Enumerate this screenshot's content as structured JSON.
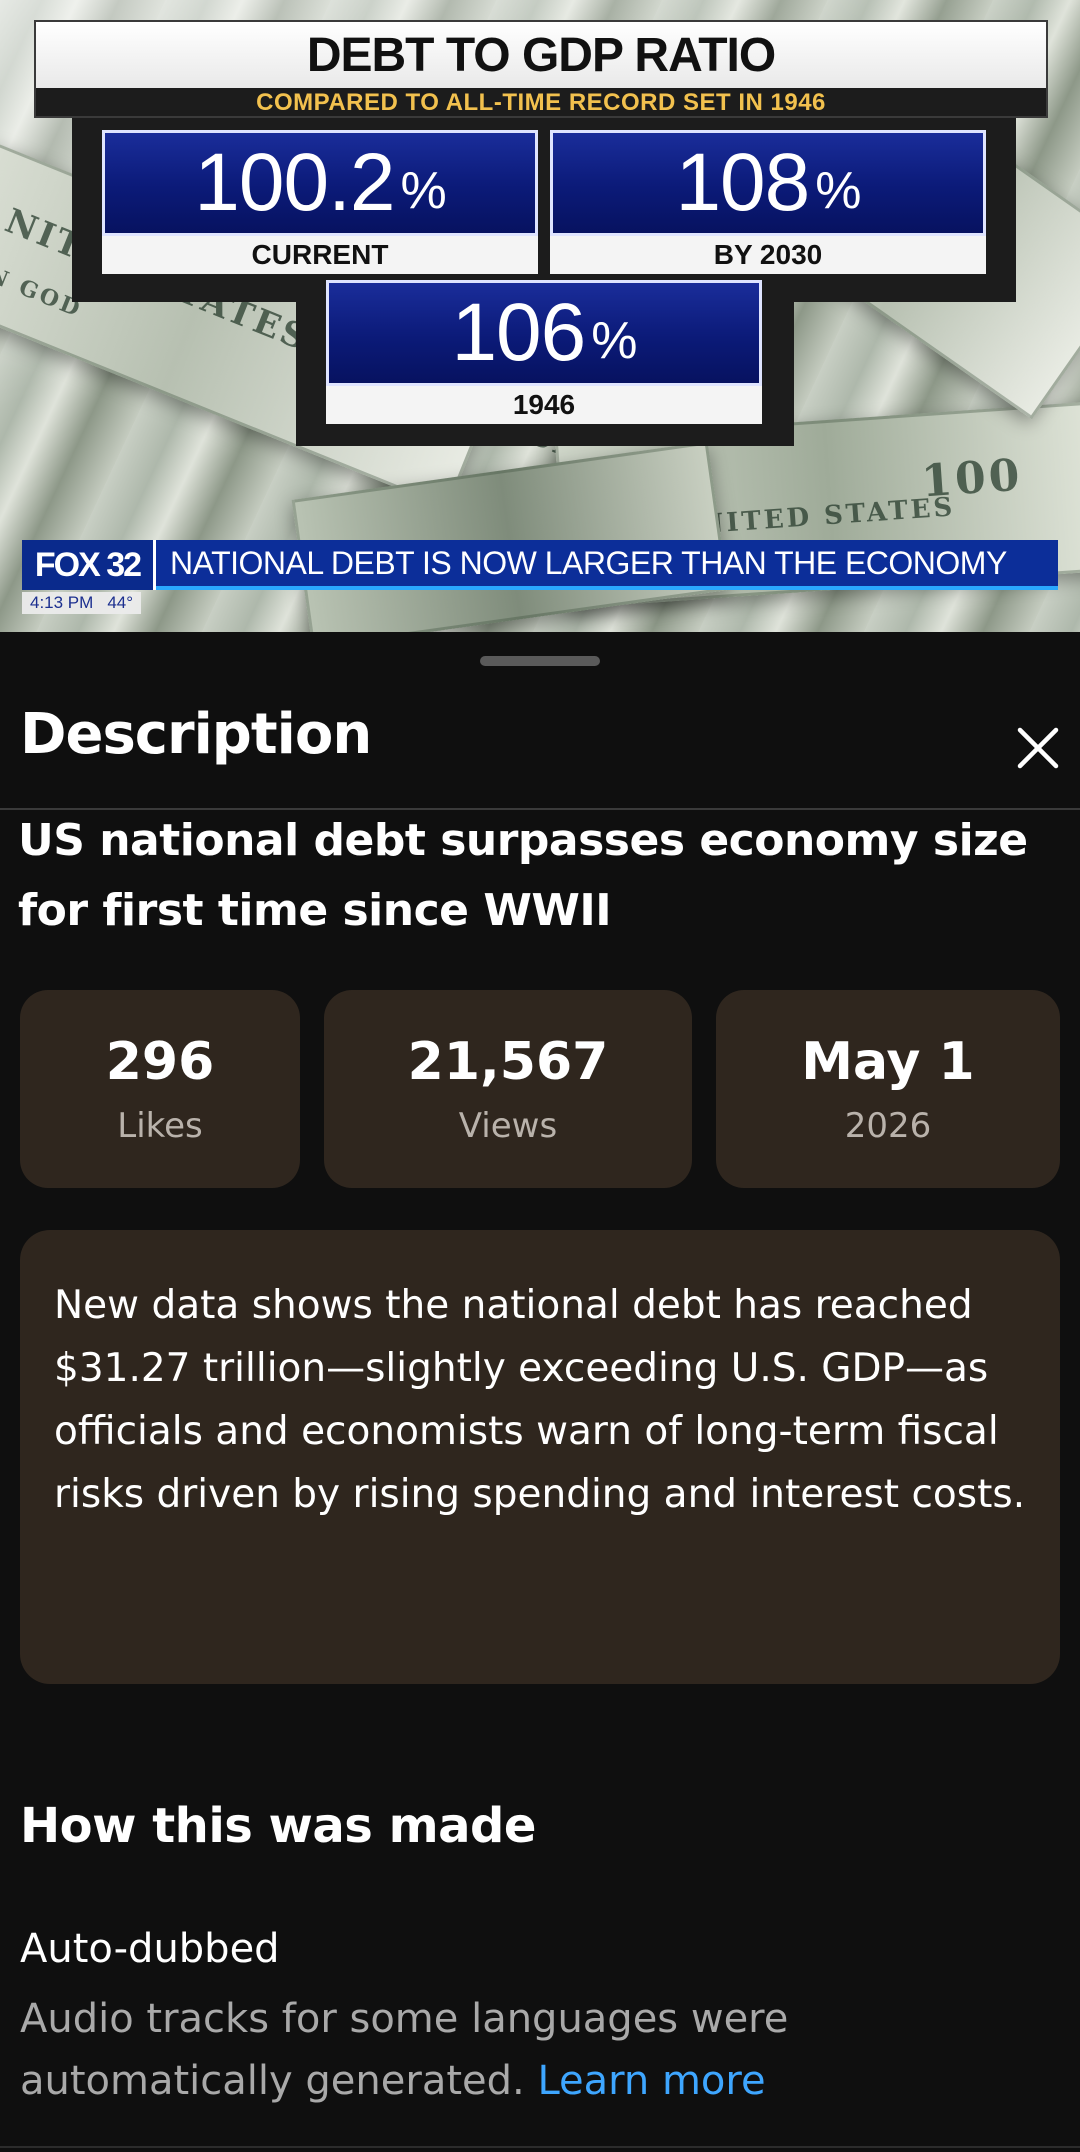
{
  "video": {
    "graphic": {
      "title": "DEBT TO GDP RATIO",
      "subtitle": "COMPARED TO ALL-TIME RECORD SET IN 1946",
      "stats": [
        {
          "value": "100.2",
          "unit": "%",
          "label": "CURRENT"
        },
        {
          "value": "108",
          "unit": "%",
          "label": "BY 2030"
        },
        {
          "value": "106",
          "unit": "%",
          "label": "1946"
        }
      ]
    },
    "channel_logo": "FOX 32",
    "headline": "NATIONAL DEBT IS NOW LARGER THAN THE ECONOMY",
    "time": "4:13 PM",
    "temperature": "44°",
    "background_text": {
      "bill1": "NITED STATES OF AMERICA",
      "bill2": "IN GOD",
      "bill3": "UNITED STATES",
      "bill4": "100"
    }
  },
  "sheet": {
    "title": "Description",
    "close_icon": "close-icon",
    "video_title": "US national debt surpasses economy size for first time since WWII",
    "stats": {
      "likes": {
        "value": "296",
        "caption": "Likes"
      },
      "views": {
        "value": "21,567",
        "caption": "Views"
      },
      "date": {
        "value": "May 1",
        "caption": "2026"
      }
    },
    "summary": "New data shows the national debt has reached $31.27 trillion—slightly exceeding U.S. GDP—as officials and economists warn of long-term fiscal risks driven by rising spending and interest costs.",
    "how_made": {
      "heading": "How this was made",
      "item_title": "Auto-dubbed",
      "item_desc": "Audio tracks for some languages were automatically generated.",
      "link": "Learn more"
    }
  },
  "colors": {
    "sheet_background": "#0f0f0f",
    "card_background": "#2f261e",
    "link": "#3ea6ff",
    "graphic_blue": "#0b1a78",
    "graphic_gold": "#f2c14e"
  }
}
